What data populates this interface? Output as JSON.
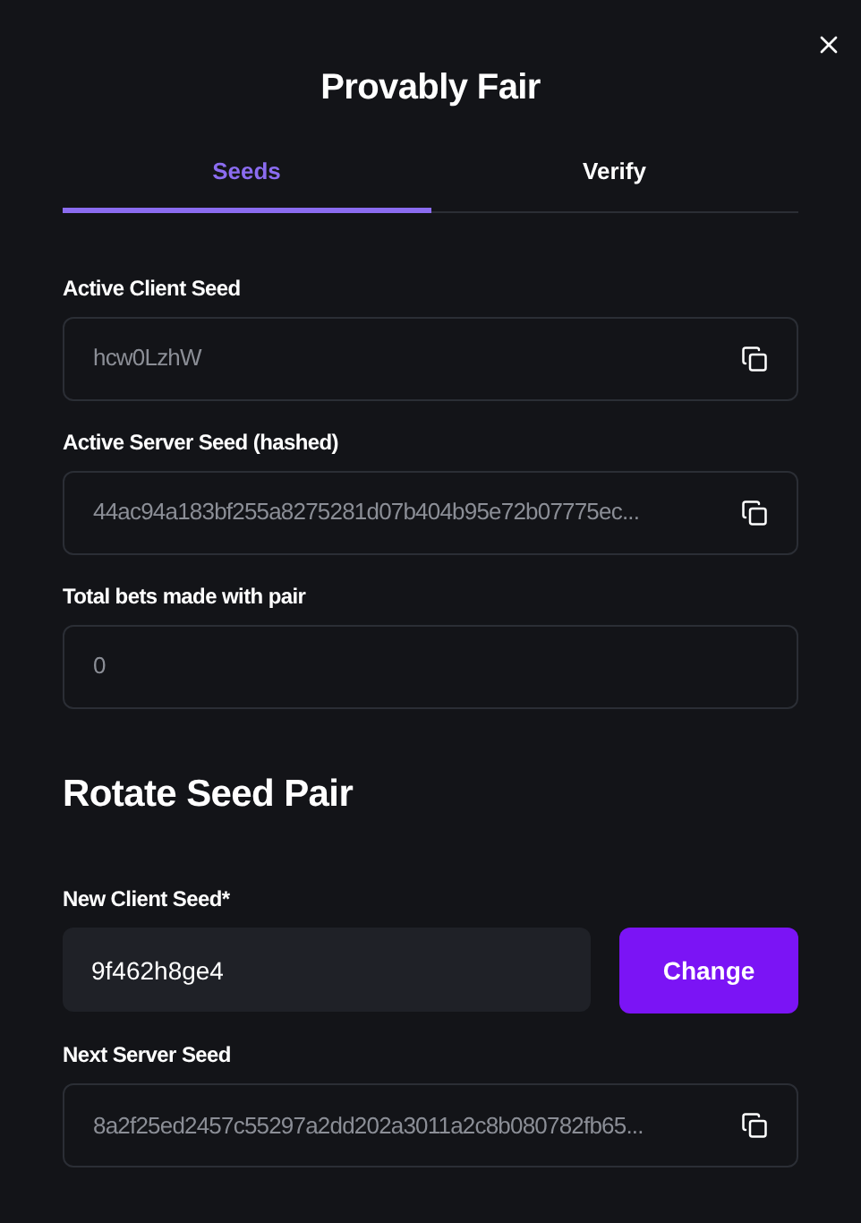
{
  "title": "Provably Fair",
  "tabs": [
    {
      "label": "Seeds",
      "selected": true
    },
    {
      "label": "Verify",
      "selected": false
    }
  ],
  "fields": [
    {
      "label": "Active Client Seed",
      "value": "hcw0LzhW",
      "kind": "copy"
    },
    {
      "label": "Active Server Seed (hashed)",
      "value": "44ac94a183bf255a8275281d07b404b95e72b07775ec...",
      "kind": "copy"
    },
    {
      "label": "Total bets made with pair",
      "value": "0",
      "kind": "plain"
    }
  ],
  "rotate": {
    "heading": "Rotate Seed Pair",
    "new_seed": {
      "label": "New Client Seed*",
      "value": "9f462h8ge4"
    },
    "button": "Change",
    "next_seed": {
      "label": "Next Server Seed",
      "value": "8a2f25ed2457c55297a2dd202a3011a2c8b080782fb65...",
      "kind": "copy"
    }
  }
}
